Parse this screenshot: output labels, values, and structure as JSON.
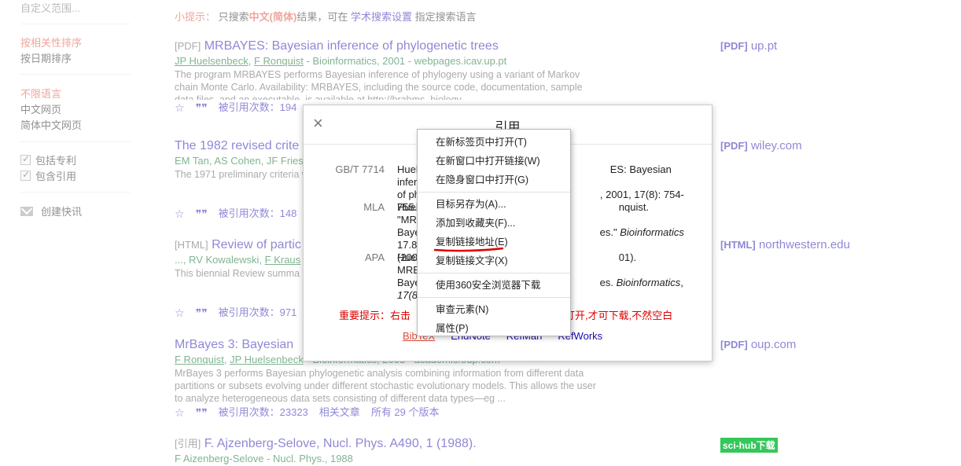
{
  "sidebar": {
    "custom_range": "自定义范围...",
    "sort_relevance": "按相关性排序",
    "sort_date": "按日期排序",
    "lang_any": "不限语言",
    "lang_zh_pages": "中文网页",
    "lang_zh_simplified": "简体中文网页",
    "include_patents": "包括专利",
    "include_citations": "包含引用",
    "create_alert": "创建快讯"
  },
  "hint": {
    "label": "小提示：",
    "pre": "只搜索",
    "bold": "中文(简体)",
    "mid": "结果，可在",
    "link": "学术搜索设置",
    "post": "指定搜索语言"
  },
  "results": [
    {
      "type": "[PDF]",
      "title": "MRBAYES: Bayesian inference of phylogenetic trees",
      "author1": "JP Huelsenbeck",
      "sep": ", ",
      "author2": "F Ronquist",
      "source": " - Bioinformatics, 2001 - webpages.icav.up.pt",
      "snippet": "The program MRBAYES performs Bayesian inference of phylogeny using a variant of Markov chain Monte Carlo. Availability: MRBAYES, including the source code, documentation, sample data files, and an executable, is available at http://brahms. biology ...",
      "cited": "被引用次数：194",
      "side_type": "[PDF]",
      "side": "up.pt"
    },
    {
      "type": "",
      "title": "The 1982 revised crite",
      "meta": "EM Tan, AS Cohen, JF Fries",
      "snippet": "The 1971 preliminary criteria were revised and updated to classification. The 1982 revis",
      "cited": "被引用次数：148",
      "side_type": "[PDF]",
      "side": "wiley.com"
    },
    {
      "type": "[HTML]",
      "title": "Review of partic",
      "meta_pre": "..., RV Kowalewski, ",
      "meta_link": "F Kraus",
      "snippet": "This biennial Review summa editions, plus 2658 new mea measured properties of gaug",
      "cited": "被引用次数：971",
      "side_type": "[HTML]",
      "side": "northwestern.edu"
    },
    {
      "type": "",
      "title": "MrBayes 3: Bayesian",
      "author1": "F Ronquist",
      "sep": ", ",
      "author2": "JP Huelsenbeck",
      "source": " - Bioinformatics, 2003 - academic.oup.com",
      "snippet": "MrBayes 3 performs Bayesian phylogenetic analysis combining information from different data partitions or subsets evolving under different stochastic evolutionary models. This allows the user to analyze heterogeneous data sets consisting of different data types—eg ...",
      "cited": "被引用次数：23323",
      "related": "相关文章",
      "versions": "所有 29 个版本",
      "side_type": "[PDF]",
      "side": "oup.com"
    },
    {
      "type": "[引用]",
      "title": "F. Ajzenberg-Selove, Nucl. Phys. A490, 1 (1988).",
      "meta": "F Aizenberg-Selove - Nucl. Phys., 1988"
    }
  ],
  "scihub": "sci-hub下载",
  "modal": {
    "title": "引用",
    "close": "×",
    "citations": [
      {
        "label": "GB/T 7714",
        "l1": "Huel",
        "l1b": "ES: Bayesian inference",
        "l2": "of ph",
        "l2b": ", 2001, 17(8): 754-755."
      },
      {
        "label": "MLA",
        "l1": "Huel",
        "l1b": "nquist. \"MRBAYES:",
        "l2": "Baye",
        "l2b": "es.\"",
        "l2i": "Bioinformatics",
        "l2c": "17.8",
        "l3": "(200"
      },
      {
        "label": "APA",
        "l1": "Huel",
        "l1b": "01). MRBAYES:",
        "l2": "Baye",
        "l2b": "es.",
        "l2i": "Bioinformatics",
        "l2c": ",",
        "l3": "17(8"
      }
    ],
    "warning_pre": "重要提示：右击",
    "warning_post": "打开,才可下载,不然空白",
    "exports": [
      "BibTeX",
      "EndNote",
      "RefMan",
      "RefWorks"
    ]
  },
  "context_menu": [
    "在新标签页中打开(T)",
    "在新窗口中打开链接(W)",
    "在隐身窗口中打开(G)",
    "目标另存为(A)...",
    "添加到收藏夹(F)...",
    "复制链接地址(E)",
    "复制链接文字(X)",
    "使用360安全浏览器下载",
    "审查元素(N)",
    "属性(P)"
  ],
  "colors": {
    "accent_red": "#dd4b39",
    "link_blue": "#1a0dab",
    "green": "#006621",
    "scihub_green": "#34c759"
  }
}
